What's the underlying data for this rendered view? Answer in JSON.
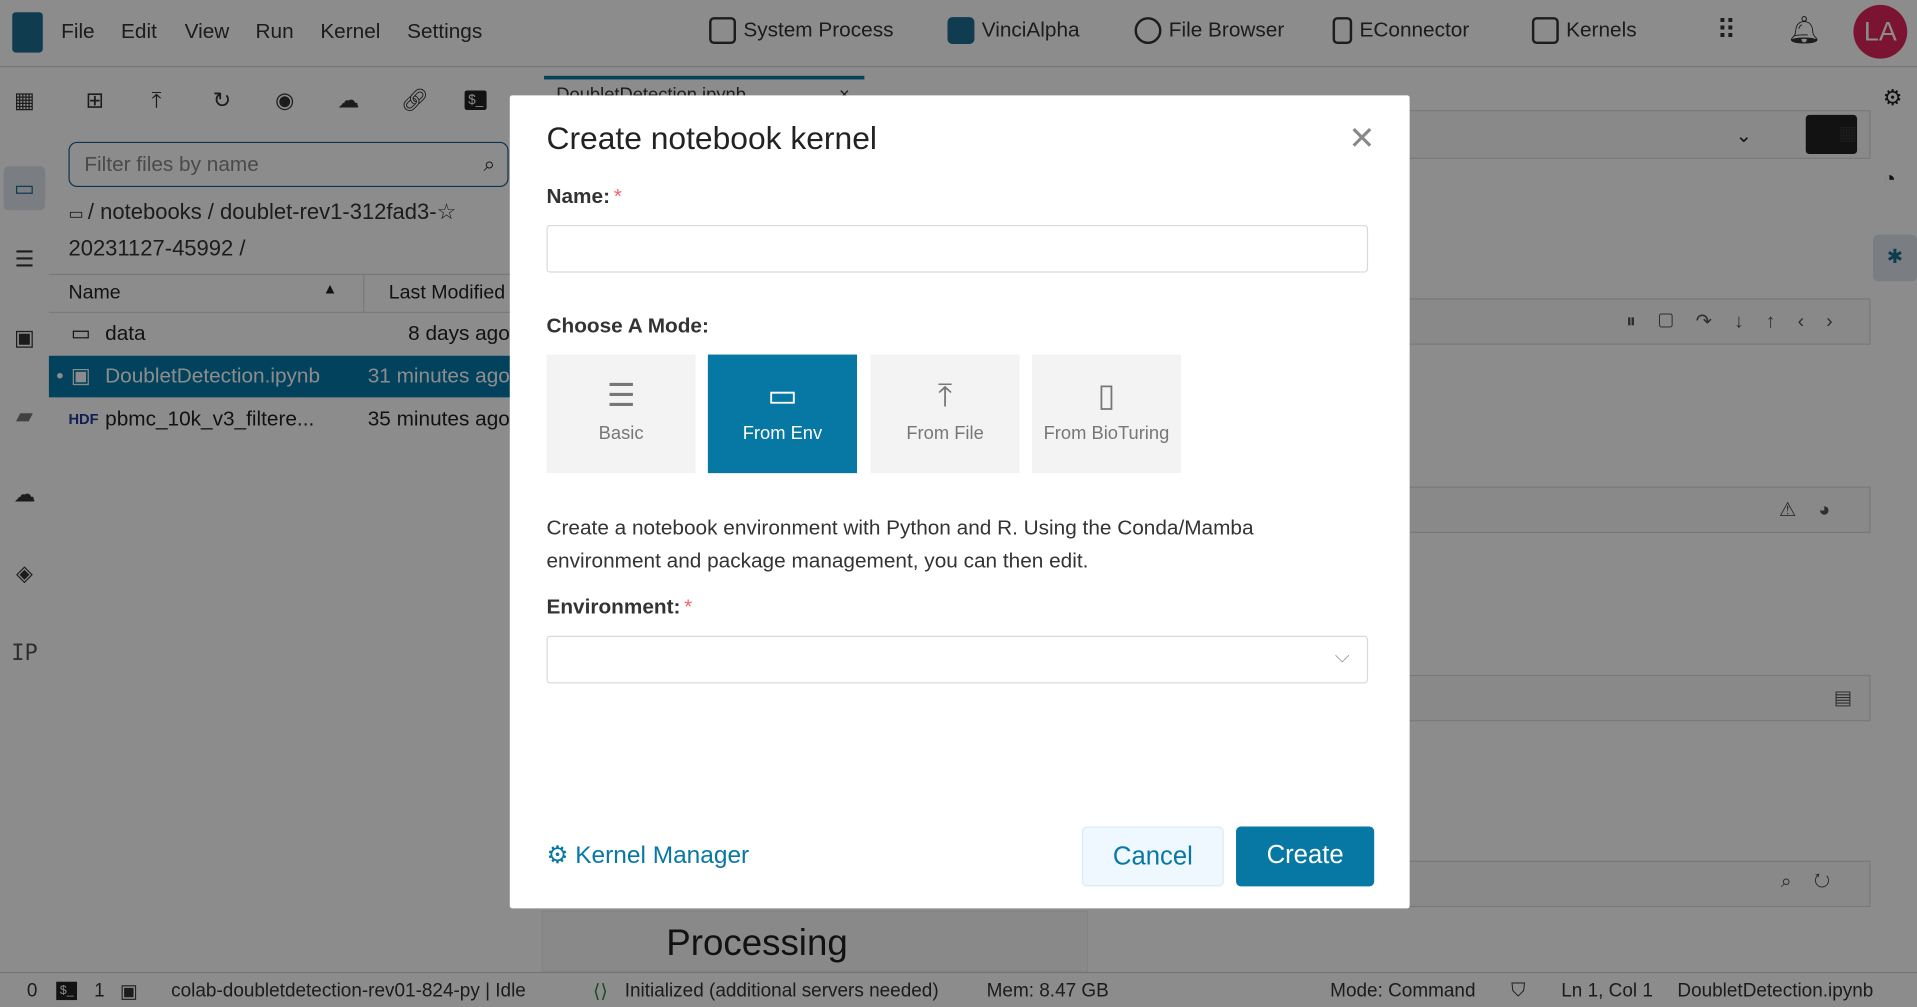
{
  "menu": [
    "File",
    "Edit",
    "View",
    "Run",
    "Kernel",
    "Settings"
  ],
  "nav": [
    {
      "label": "System Process",
      "icon": "monitor-gear-icon"
    },
    {
      "label": "VinciAlpha",
      "icon": "vincialpha-icon"
    },
    {
      "label": "File Browser",
      "icon": "globe-file-icon"
    },
    {
      "label": "EConnector",
      "icon": "plug-icon"
    },
    {
      "label": "Kernels",
      "icon": "chip-atom-icon"
    }
  ],
  "user": {
    "initials": "LA",
    "color": "#e0245e"
  },
  "filebrowser": {
    "filter_placeholder": "Filter files by name",
    "breadcrumb1": "/ notebooks / doublet-rev1-312fad3-",
    "breadcrumb2": "20231127-45992 /",
    "col_name": "Name",
    "col_modified": "Last Modified",
    "files": [
      {
        "name": "data",
        "modified": "8 days ago",
        "icon": "folder-icon"
      },
      {
        "name": "DoubletDetection.ipynb",
        "modified": "31 minutes ago",
        "icon": "notebook-icon",
        "selected": true
      },
      {
        "name": "pbmc_10k_v3_filtere...",
        "modified": "35 minutes ago",
        "icon": "hdf-icon"
      }
    ]
  },
  "left_ip": "IP",
  "notebook": {
    "tab": "DoubletDetection.ipynb",
    "heading": "Processing"
  },
  "status": {
    "n0": "0",
    "n1": "1",
    "kernel": "colab-doubletdetection-rev01-824-py | Idle",
    "lsp": "Initialized (additional servers needed)",
    "mem": "Mem: 8.47 GB",
    "mode": "Mode: Command",
    "pos": "Ln 1, Col 1",
    "file": "DoubletDetection.ipynb"
  },
  "dialog": {
    "title": "Create notebook kernel",
    "name_label": "Name:",
    "name_value": "",
    "mode_label": "Choose A Mode:",
    "modes": [
      {
        "label": "Basic",
        "icon": "list-icon",
        "active": false
      },
      {
        "label": "From Env",
        "icon": "window-icon",
        "active": true
      },
      {
        "label": "From File",
        "icon": "upload-icon",
        "active": false
      },
      {
        "label": "From BioTuring",
        "icon": "wallet-icon",
        "active": false
      }
    ],
    "description": "Create a notebook environment with Python and R. Using the Conda/Mamba environment and package management, you can then edit.",
    "env_label": "Environment:",
    "env_value": "",
    "kernel_manager": "Kernel Manager",
    "cancel": "Cancel",
    "create": "Create",
    "accent": "#0778a4"
  }
}
